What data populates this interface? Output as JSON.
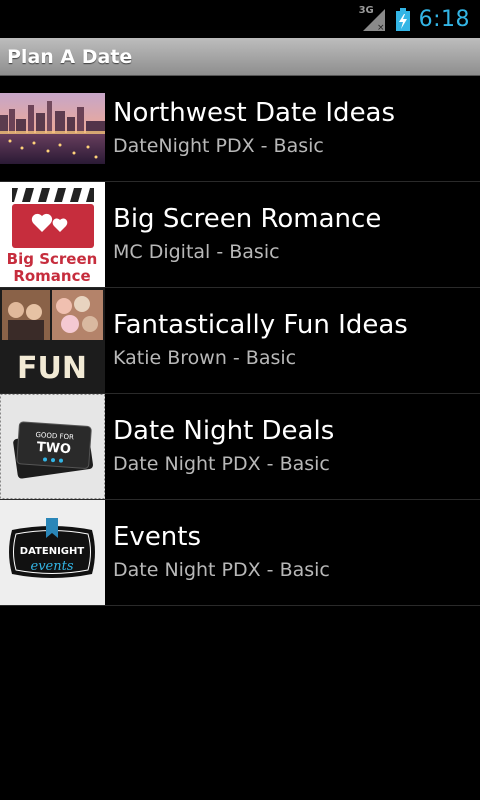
{
  "status_bar": {
    "network": "3G",
    "time": "6:18"
  },
  "title_bar": {
    "title": "Plan A Date"
  },
  "items": [
    {
      "title": "Northwest Date Ideas",
      "subtitle": "DateNight PDX - Basic",
      "icon": "city-waterfront-image"
    },
    {
      "title": "Big Screen Romance",
      "subtitle": "MC Digital - Basic",
      "icon": "clapperboard-heart-image",
      "logo_text": [
        "Big Screen",
        "Romance"
      ]
    },
    {
      "title": "Fantastically Fun Ideas",
      "subtitle": "Katie Brown - Basic",
      "icon": "fun-collage-image",
      "logo_text": [
        "FUN"
      ]
    },
    {
      "title": "Date Night Deals",
      "subtitle": "Date Night PDX - Basic",
      "icon": "tickets-image",
      "logo_text": [
        "GOOD FOR",
        "TWO"
      ]
    },
    {
      "title": "Events",
      "subtitle": "Date Night PDX - Basic",
      "icon": "events-badge-image",
      "logo_text": [
        "DATENIGHT",
        "events"
      ]
    }
  ],
  "colors": {
    "clock": "#33b5e5",
    "background": "#000000",
    "subtitle": "#b8b8b8"
  }
}
